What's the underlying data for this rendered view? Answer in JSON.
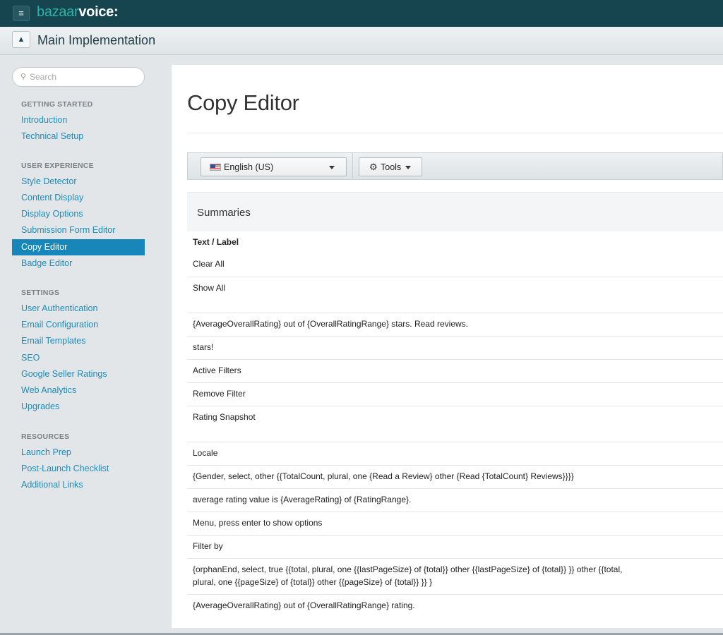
{
  "app": {
    "logo_part1": "bazaar",
    "logo_part2": "voice:",
    "menu_icon": "menu-icon",
    "home_icon": "home-icon",
    "section_title": "Main Implementation"
  },
  "search": {
    "placeholder": "Search"
  },
  "sidebar": {
    "sections": [
      {
        "heading": "GETTING STARTED",
        "items": [
          "Introduction",
          "Technical Setup"
        ]
      },
      {
        "heading": "USER EXPERIENCE",
        "items": [
          "Style Detector",
          "Content Display",
          "Display Options",
          "Submission Form Editor",
          "Copy Editor",
          "Badge Editor"
        ]
      },
      {
        "heading": "SETTINGS",
        "items": [
          "User Authentication",
          "Email Configuration",
          "Email Templates",
          "SEO",
          "Google Seller Ratings",
          "Web Analytics",
          "Upgrades"
        ]
      },
      {
        "heading": "RESOURCES",
        "items": [
          "Launch Prep",
          "Post-Launch Checklist",
          "Additional Links"
        ]
      }
    ],
    "active_item": "Copy Editor"
  },
  "main": {
    "title": "Copy Editor",
    "toolbar": {
      "language": "English (US)",
      "language_icon": "us-flag-icon",
      "tools": "Tools",
      "tools_icon": "gear-icon"
    },
    "card": {
      "title": "Summaries",
      "column_header": "Text / Label",
      "rows": [
        "Clear All",
        "Show All",
        "{AverageOverallRating} out of {OverallRatingRange} stars. Read reviews.",
        "stars!",
        "Active Filters",
        "Remove Filter",
        "Rating Snapshot",
        "Locale",
        "{Gender, select, other {{TotalCount, plural, one {Read a Review} other {Read {TotalCount} Reviews}}}}",
        "average rating value is {AverageRating} of {RatingRange}.",
        "Menu, press enter to show options",
        "Filter by",
        "{orphanEnd, select, true {{total, plural, one {{lastPageSize} of {total}} other {{lastPageSize} of {total}} }} other {{total, plural, one {{pageSize} of {total}} other {{pageSize} of {total}} }} }",
        "{AverageOverallRating} out of {OverallRatingRange} rating."
      ]
    }
  },
  "colors": {
    "topbar": "#16444f",
    "logo_accent": "#2bb3a8",
    "link": "#1c8cb8",
    "active_nav": "#1687b8"
  }
}
